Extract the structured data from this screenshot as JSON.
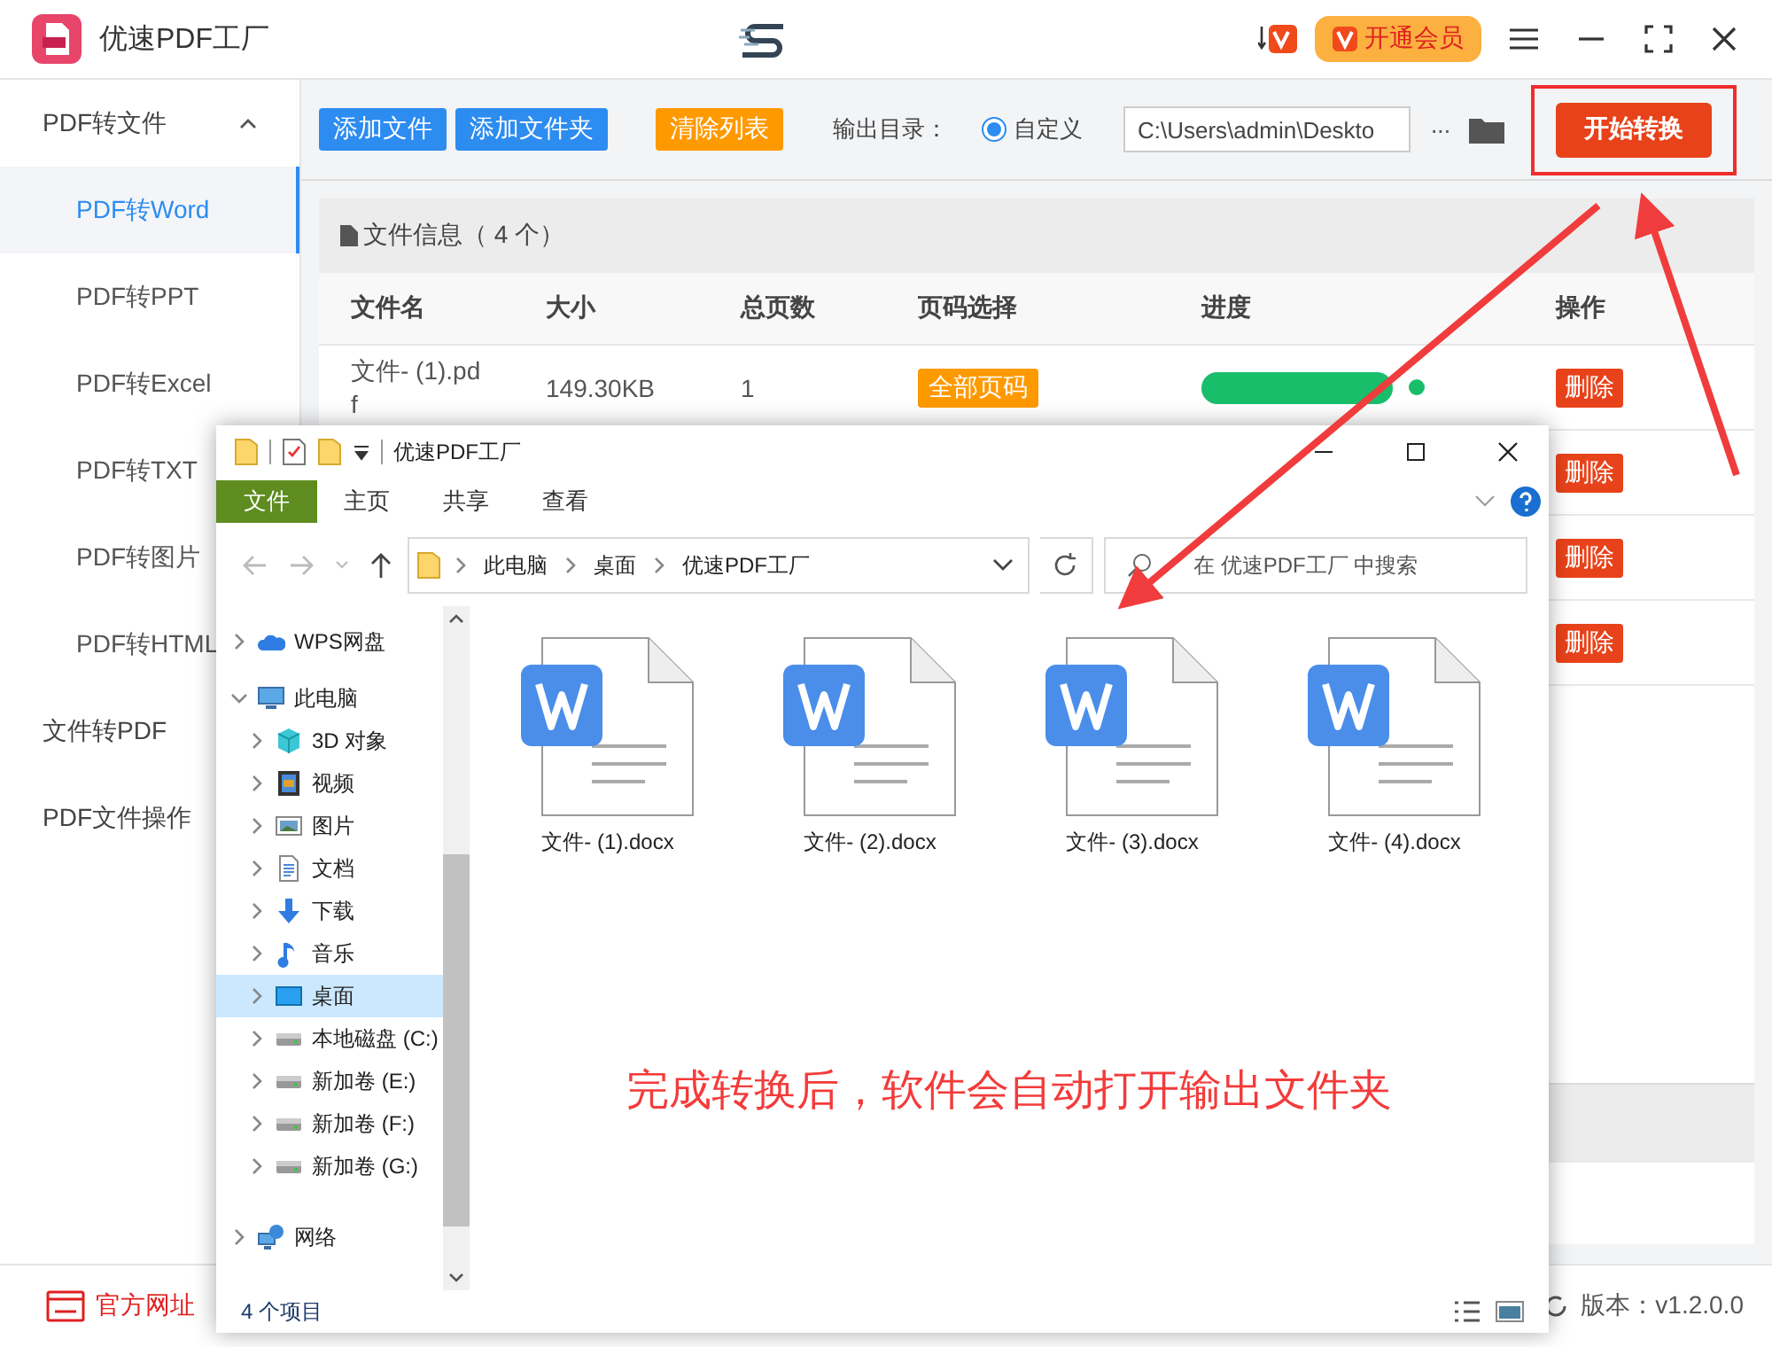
{
  "app": {
    "title": "优速PDF工厂",
    "vip_button": "开通会员"
  },
  "sidebar": {
    "items": [
      {
        "label": "PDF转文件",
        "expanded": true,
        "children": [
          {
            "label": "PDF转Word",
            "selected": true
          },
          {
            "label": "PDF转PPT",
            "selected": false
          },
          {
            "label": "PDF转Excel",
            "selected": false
          },
          {
            "label": "PDF转TXT",
            "selected": false
          },
          {
            "label": "PDF转图片",
            "selected": false
          },
          {
            "label": "PDF转HTML",
            "selected": false
          }
        ]
      },
      {
        "label": "文件转PDF",
        "selected": false
      },
      {
        "label": "PDF文件操作",
        "selected": false
      }
    ]
  },
  "toolbar": {
    "buttons": [
      {
        "label": "添加文件",
        "kind": "primary"
      },
      {
        "label": "添加文件夹",
        "kind": "primary"
      },
      {
        "label": "清除列表",
        "kind": "warning"
      }
    ],
    "output_label": "输出目录：",
    "radio": {
      "label": "自定义",
      "checked": true
    },
    "path": "C:\\Users\\admin\\Deskto",
    "more": "···",
    "start_button": "开始转换"
  },
  "table": {
    "title": "文件信息（ 4 个）",
    "columns": [
      "文件名",
      "大小",
      "总页数",
      "页码选择",
      "进度",
      "操作"
    ],
    "rows": [
      {
        "name": "文件- (1).pd f",
        "size": "149.30KB",
        "pages": "1",
        "page_select": "全部页码",
        "level": 1,
        "action": "删除"
      },
      {
        "action": "删除"
      },
      {
        "action": "删除"
      },
      {
        "action": "删除"
      }
    ]
  },
  "footer": {
    "website": "官方网址",
    "version": "版本：v1.2.0.0"
  },
  "explorer": {
    "title": "优速PDF工厂",
    "file_button": "文件",
    "tabs": [
      "主页",
      "共享",
      "查看"
    ],
    "breadcrumb": [
      "此电脑",
      "桌面",
      "优速PDF工厂"
    ],
    "search": {
      "placeholder": "在 优速PDF工厂 中搜索"
    },
    "nav": [
      {
        "label": "WPS网盘",
        "kind": "cloud",
        "expanded": false,
        "selected": false
      },
      {
        "label": "此电脑",
        "kind": "computer",
        "expanded": true,
        "selected": false,
        "children": [
          {
            "label": "3D 对象",
            "kind": "cube",
            "expanded": false,
            "selected": false
          },
          {
            "label": "视频",
            "kind": "film",
            "expanded": false,
            "selected": false
          },
          {
            "label": "图片",
            "kind": "picture",
            "expanded": false,
            "selected": false
          },
          {
            "label": "文档",
            "kind": "document",
            "expanded": false,
            "selected": false
          },
          {
            "label": "下载",
            "kind": "download",
            "expanded": false,
            "selected": false
          },
          {
            "label": "音乐",
            "kind": "music",
            "expanded": false,
            "selected": false
          },
          {
            "label": "桌面",
            "kind": "desktop",
            "expanded": false,
            "selected": true
          },
          {
            "label": "本地磁盘 (C:)",
            "kind": "drive",
            "expanded": false,
            "selected": false
          },
          {
            "label": "新加卷 (E:)",
            "kind": "drive",
            "expanded": false,
            "selected": false
          },
          {
            "label": "新加卷 (F:)",
            "kind": "drive",
            "expanded": false,
            "selected": false
          },
          {
            "label": "新加卷 (G:)",
            "kind": "drive",
            "expanded": false,
            "selected": false
          }
        ]
      },
      {
        "label": "网络",
        "kind": "network",
        "expanded": false,
        "selected": false
      }
    ],
    "files": [
      {
        "name": "文件- (1).docx"
      },
      {
        "name": "文件- (2).docx"
      },
      {
        "name": "文件- (3).docx"
      },
      {
        "name": "文件- (4).docx"
      }
    ],
    "caption": "完成转换后，软件会自动打开输出文件夹",
    "status": "4 个项目"
  }
}
